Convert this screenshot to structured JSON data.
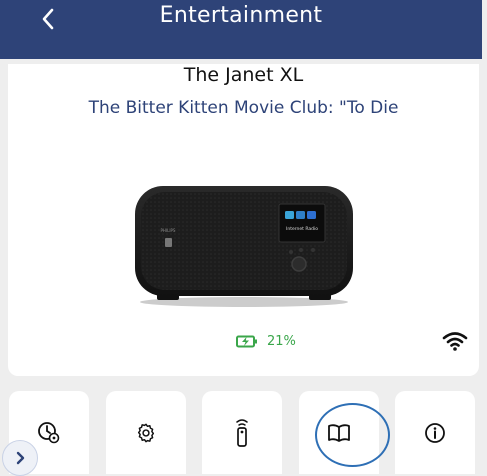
{
  "header": {
    "title": "Entertainment",
    "back_icon": "chevron-left-icon"
  },
  "device": {
    "name": "The Janet XL",
    "now_playing": "The Bitter Kitten Movie Club: \"To Die",
    "screen_label": "Internet Radio",
    "brand": "PHILIPS"
  },
  "status": {
    "battery_percent": "21%",
    "battery_icon": "battery-charging-icon",
    "wifi_icon": "wifi-icon"
  },
  "toolbar": {
    "items": [
      {
        "name": "alarm-settings",
        "icon": "clock-settings-icon"
      },
      {
        "name": "settings",
        "icon": "gear-icon"
      },
      {
        "name": "remote",
        "icon": "remote-control-icon"
      },
      {
        "name": "manual",
        "icon": "book-icon",
        "highlighted": true
      },
      {
        "name": "info",
        "icon": "info-icon"
      }
    ]
  },
  "floating": {
    "icon": "chevron-right-icon"
  },
  "colors": {
    "header_bg": "#2e4378",
    "accent_blue": "#2e6fb5",
    "battery_green": "#3aa64a",
    "page_bg": "#eeeeee"
  }
}
